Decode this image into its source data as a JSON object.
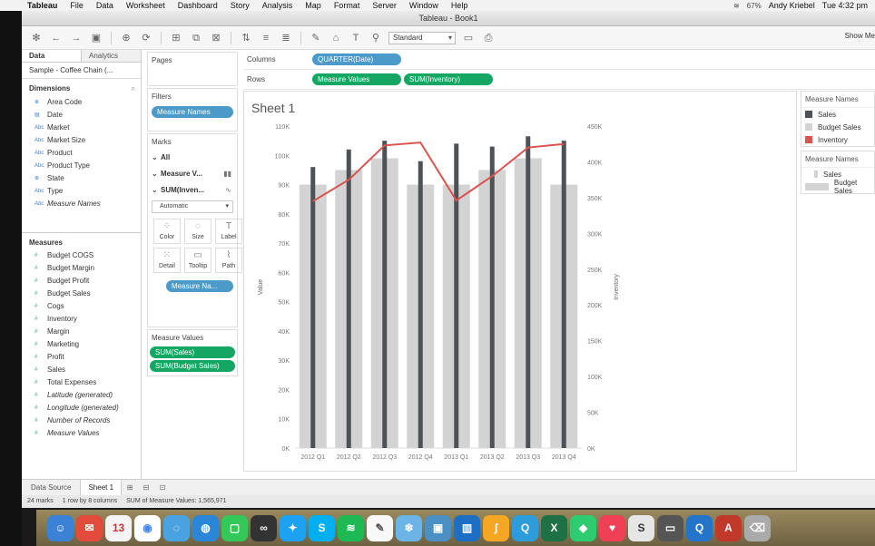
{
  "menubar": {
    "apple": "",
    "items": [
      "Tableau",
      "File",
      "Data",
      "Worksheet",
      "Dashboard",
      "Story",
      "Analysis",
      "Map",
      "Format",
      "Server",
      "Window",
      "Help"
    ],
    "battery": "67%",
    "user": "Andy Kriebel",
    "clock": "Tue 4:32 pm"
  },
  "window": {
    "title": "Tableau - Book1"
  },
  "toolbar": {
    "fit": "Standard",
    "show_me": "Show Me"
  },
  "left": {
    "tabs": [
      "Data",
      "Analytics"
    ],
    "datasource": "Sample - Coffee Chain (...",
    "dimensions_title": "Dimensions",
    "dimensions": [
      {
        "icon": "globe",
        "label": "Area Code",
        "italic": false
      },
      {
        "icon": "calendar",
        "label": "Date",
        "italic": false
      },
      {
        "icon": "Abc",
        "label": "Market",
        "italic": false
      },
      {
        "icon": "Abc",
        "label": "Market Size",
        "italic": false
      },
      {
        "icon": "Abc",
        "label": "Product",
        "italic": false
      },
      {
        "icon": "Abc",
        "label": "Product Type",
        "italic": false
      },
      {
        "icon": "globe",
        "label": "State",
        "italic": false
      },
      {
        "icon": "Abc",
        "label": "Type",
        "italic": false
      },
      {
        "icon": "Abc",
        "label": "Measure Names",
        "italic": true
      }
    ],
    "measures_title": "Measures",
    "measures": [
      {
        "label": "Budget COGS",
        "italic": false
      },
      {
        "label": "Budget Margin",
        "italic": false
      },
      {
        "label": "Budget Profit",
        "italic": false
      },
      {
        "label": "Budget Sales",
        "italic": false
      },
      {
        "label": "Cogs",
        "italic": false
      },
      {
        "label": "Inventory",
        "italic": false
      },
      {
        "label": "Margin",
        "italic": false
      },
      {
        "label": "Marketing",
        "italic": false
      },
      {
        "label": "Profit",
        "italic": false
      },
      {
        "label": "Sales",
        "italic": false
      },
      {
        "label": "Total Expenses",
        "italic": false
      },
      {
        "label": "Latitude (generated)",
        "italic": true
      },
      {
        "label": "Longitude (generated)",
        "italic": true
      },
      {
        "label": "Number of Records",
        "italic": true
      },
      {
        "label": "Measure Values",
        "italic": true
      }
    ]
  },
  "mid": {
    "pages": "Pages",
    "filters": "Filters",
    "filter_pill": "Measure Names",
    "marks": "Marks",
    "marks_rows": [
      "All",
      "Measure V...",
      "SUM(Inven..."
    ],
    "mark_type": "Automatic",
    "mark_buttons": [
      "Color",
      "Size",
      "Label",
      "Detail",
      "Tooltip",
      "Path"
    ],
    "color_pill": "Measure Na...",
    "mv_title": "Measure Values",
    "mv_pills": [
      "SUM(Sales)",
      "SUM(Budget Sales)"
    ]
  },
  "shelves": {
    "columns_label": "Columns",
    "columns_pill": "QUARTER(Date)",
    "rows_label": "Rows",
    "rows_pills": [
      "Measure Values",
      "SUM(Inventory)"
    ]
  },
  "sheet": {
    "title": "Sheet 1"
  },
  "chart_data": {
    "type": "bar",
    "categories": [
      "2012 Q1",
      "2012 Q2",
      "2012 Q3",
      "2012 Q4",
      "2013 Q1",
      "2013 Q2",
      "2013 Q3",
      "2013 Q4"
    ],
    "series": [
      {
        "name": "Sales",
        "color": "#4e5257",
        "values": [
          96000,
          102000,
          105000,
          98000,
          104000,
          103000,
          106500,
          105000
        ]
      },
      {
        "name": "Budget Sales",
        "color": "#d3d3d3",
        "values": [
          90000,
          95000,
          99000,
          90000,
          90000,
          95000,
          99000,
          90000
        ]
      },
      {
        "name": "Inventory",
        "color": "#d9534f",
        "type": "line",
        "axis": "right",
        "values": [
          345000,
          375000,
          423000,
          427000,
          346000,
          380000,
          420000,
          425000
        ]
      }
    ],
    "ylabel": "Value",
    "y2label": "Inventory",
    "ylim": [
      0,
      110000
    ],
    "y2lim": [
      0,
      450000
    ],
    "yticks": [
      "0K",
      "10K",
      "20K",
      "30K",
      "40K",
      "50K",
      "60K",
      "70K",
      "80K",
      "90K",
      "100K",
      "110K"
    ],
    "y2ticks": [
      "0K",
      "50K",
      "100K",
      "150K",
      "200K",
      "250K",
      "300K",
      "350K",
      "400K",
      "450K"
    ]
  },
  "legend": {
    "color_title": "Measure Names",
    "color_items": [
      {
        "label": "Sales",
        "color": "#4e5257"
      },
      {
        "label": "Budget Sales",
        "color": "#d3d3d3"
      },
      {
        "label": "Inventory",
        "color": "#d9534f"
      }
    ],
    "size_title": "Measure Names",
    "size_items": [
      "Sales",
      "Budget Sales"
    ]
  },
  "bottom": {
    "datasource_tab": "Data Source",
    "sheet_tab": "Sheet 1",
    "status": [
      "24 marks",
      "1 row by 8 columns",
      "SUM of Measure Values: 1,565,971"
    ]
  }
}
